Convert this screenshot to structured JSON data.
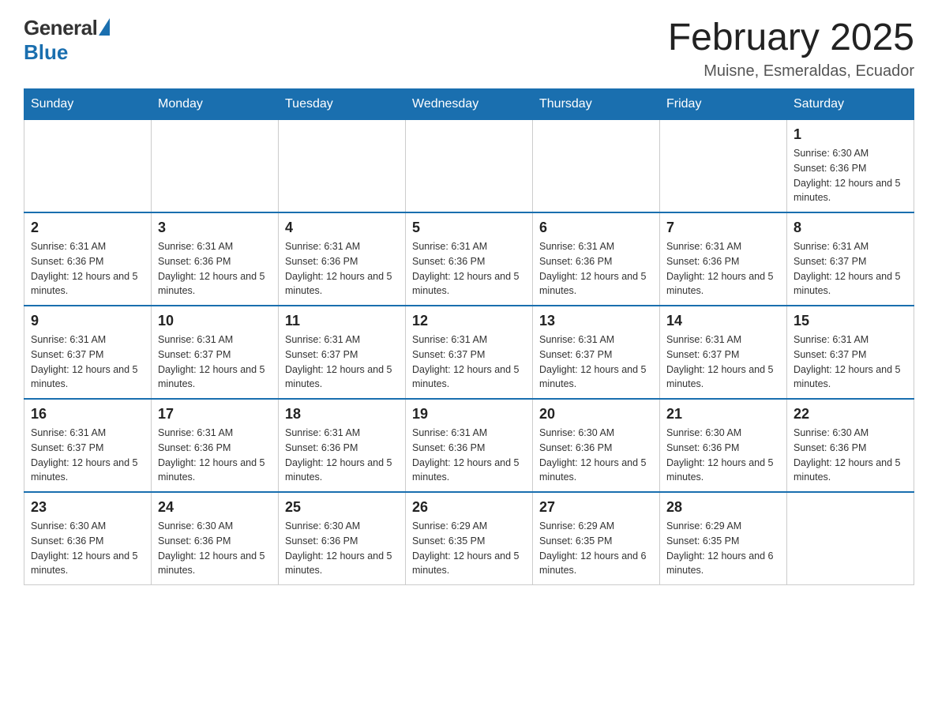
{
  "logo": {
    "general": "General",
    "blue": "Blue"
  },
  "header": {
    "title": "February 2025",
    "location": "Muisne, Esmeraldas, Ecuador"
  },
  "days_of_week": [
    "Sunday",
    "Monday",
    "Tuesday",
    "Wednesday",
    "Thursday",
    "Friday",
    "Saturday"
  ],
  "weeks": [
    [
      {
        "day": "",
        "info": ""
      },
      {
        "day": "",
        "info": ""
      },
      {
        "day": "",
        "info": ""
      },
      {
        "day": "",
        "info": ""
      },
      {
        "day": "",
        "info": ""
      },
      {
        "day": "",
        "info": ""
      },
      {
        "day": "1",
        "info": "Sunrise: 6:30 AM\nSunset: 6:36 PM\nDaylight: 12 hours and 5 minutes."
      }
    ],
    [
      {
        "day": "2",
        "info": "Sunrise: 6:31 AM\nSunset: 6:36 PM\nDaylight: 12 hours and 5 minutes."
      },
      {
        "day": "3",
        "info": "Sunrise: 6:31 AM\nSunset: 6:36 PM\nDaylight: 12 hours and 5 minutes."
      },
      {
        "day": "4",
        "info": "Sunrise: 6:31 AM\nSunset: 6:36 PM\nDaylight: 12 hours and 5 minutes."
      },
      {
        "day": "5",
        "info": "Sunrise: 6:31 AM\nSunset: 6:36 PM\nDaylight: 12 hours and 5 minutes."
      },
      {
        "day": "6",
        "info": "Sunrise: 6:31 AM\nSunset: 6:36 PM\nDaylight: 12 hours and 5 minutes."
      },
      {
        "day": "7",
        "info": "Sunrise: 6:31 AM\nSunset: 6:36 PM\nDaylight: 12 hours and 5 minutes."
      },
      {
        "day": "8",
        "info": "Sunrise: 6:31 AM\nSunset: 6:37 PM\nDaylight: 12 hours and 5 minutes."
      }
    ],
    [
      {
        "day": "9",
        "info": "Sunrise: 6:31 AM\nSunset: 6:37 PM\nDaylight: 12 hours and 5 minutes."
      },
      {
        "day": "10",
        "info": "Sunrise: 6:31 AM\nSunset: 6:37 PM\nDaylight: 12 hours and 5 minutes."
      },
      {
        "day": "11",
        "info": "Sunrise: 6:31 AM\nSunset: 6:37 PM\nDaylight: 12 hours and 5 minutes."
      },
      {
        "day": "12",
        "info": "Sunrise: 6:31 AM\nSunset: 6:37 PM\nDaylight: 12 hours and 5 minutes."
      },
      {
        "day": "13",
        "info": "Sunrise: 6:31 AM\nSunset: 6:37 PM\nDaylight: 12 hours and 5 minutes."
      },
      {
        "day": "14",
        "info": "Sunrise: 6:31 AM\nSunset: 6:37 PM\nDaylight: 12 hours and 5 minutes."
      },
      {
        "day": "15",
        "info": "Sunrise: 6:31 AM\nSunset: 6:37 PM\nDaylight: 12 hours and 5 minutes."
      }
    ],
    [
      {
        "day": "16",
        "info": "Sunrise: 6:31 AM\nSunset: 6:37 PM\nDaylight: 12 hours and 5 minutes."
      },
      {
        "day": "17",
        "info": "Sunrise: 6:31 AM\nSunset: 6:36 PM\nDaylight: 12 hours and 5 minutes."
      },
      {
        "day": "18",
        "info": "Sunrise: 6:31 AM\nSunset: 6:36 PM\nDaylight: 12 hours and 5 minutes."
      },
      {
        "day": "19",
        "info": "Sunrise: 6:31 AM\nSunset: 6:36 PM\nDaylight: 12 hours and 5 minutes."
      },
      {
        "day": "20",
        "info": "Sunrise: 6:30 AM\nSunset: 6:36 PM\nDaylight: 12 hours and 5 minutes."
      },
      {
        "day": "21",
        "info": "Sunrise: 6:30 AM\nSunset: 6:36 PM\nDaylight: 12 hours and 5 minutes."
      },
      {
        "day": "22",
        "info": "Sunrise: 6:30 AM\nSunset: 6:36 PM\nDaylight: 12 hours and 5 minutes."
      }
    ],
    [
      {
        "day": "23",
        "info": "Sunrise: 6:30 AM\nSunset: 6:36 PM\nDaylight: 12 hours and 5 minutes."
      },
      {
        "day": "24",
        "info": "Sunrise: 6:30 AM\nSunset: 6:36 PM\nDaylight: 12 hours and 5 minutes."
      },
      {
        "day": "25",
        "info": "Sunrise: 6:30 AM\nSunset: 6:36 PM\nDaylight: 12 hours and 5 minutes."
      },
      {
        "day": "26",
        "info": "Sunrise: 6:29 AM\nSunset: 6:35 PM\nDaylight: 12 hours and 5 minutes."
      },
      {
        "day": "27",
        "info": "Sunrise: 6:29 AM\nSunset: 6:35 PM\nDaylight: 12 hours and 6 minutes."
      },
      {
        "day": "28",
        "info": "Sunrise: 6:29 AM\nSunset: 6:35 PM\nDaylight: 12 hours and 6 minutes."
      },
      {
        "day": "",
        "info": ""
      }
    ]
  ]
}
